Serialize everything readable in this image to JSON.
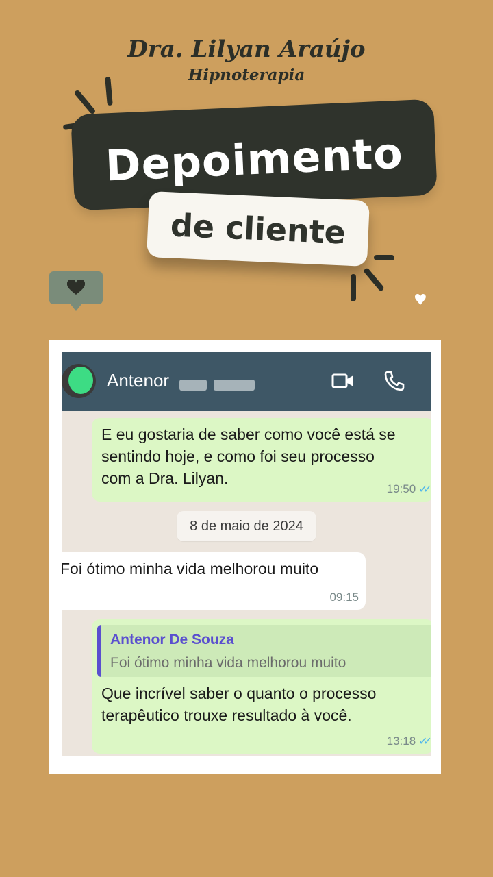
{
  "header": {
    "brand_name": "Dra. Lilyan Araújo",
    "brand_subtitle": "Hipnoterapia",
    "title": "Depoimento",
    "subtitle": "de cliente"
  },
  "icons": {
    "chat": "heart-chat-bubble-icon",
    "small_heart": "heart-icon"
  },
  "colors": {
    "background": "#cd9f5e",
    "dark": "#2f332c",
    "whatsapp_header": "#3e5766",
    "outgoing_bubble": "#dcf7c5",
    "incoming_bubble": "#ffffff",
    "read_ticks": "#4fb6ec",
    "quote_accent": "#5a4fcf"
  },
  "chat": {
    "contact_name": "Antenor",
    "header_icons": [
      "video-call-icon",
      "phone-icon"
    ],
    "messages": [
      {
        "direction": "outgoing",
        "lines": [
          "E eu gostaria de saber como você está se",
          "sentindo hoje, e como foi seu processo",
          "com a Dra. Lilyan."
        ],
        "time": "19:50",
        "status": "read"
      },
      {
        "direction": "incoming",
        "text": "Foi ótimo minha vida melhorou muito",
        "time": "09:15"
      },
      {
        "direction": "outgoing",
        "quoted_author": "Antenor De Souza",
        "quoted_text": "Foi ótimo minha vida melhorou muito",
        "lines": [
          "Que incrível saber o quanto o processo",
          "terapêutico trouxe resultado à você."
        ],
        "time": "13:18",
        "status": "read"
      }
    ],
    "date_separator": "8 de maio de 2024"
  }
}
